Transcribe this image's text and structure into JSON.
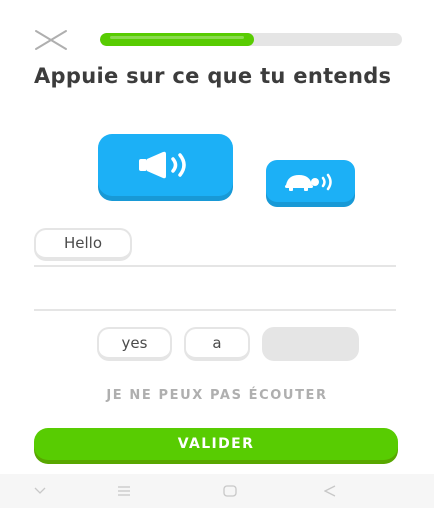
{
  "progress": {
    "fraction": 0.51,
    "color": "#58cc02"
  },
  "title": "Appuie sur ce que tu entends",
  "speaker_buttons": {
    "normal_icon": "speaker-icon",
    "slow_icon": "turtle-speaker-icon",
    "color": "#1cb0f6"
  },
  "answer": {
    "selected_words": [
      "Hello"
    ]
  },
  "word_bank": {
    "words": [
      "yes",
      "a"
    ]
  },
  "cant_listen_label": "JE NE PEUX PAS ÉCOUTER",
  "validate_label": "VALIDER",
  "nav_bar": {
    "icons": [
      "chevron-down-icon",
      "menu-icon",
      "home-icon",
      "back-icon"
    ]
  }
}
